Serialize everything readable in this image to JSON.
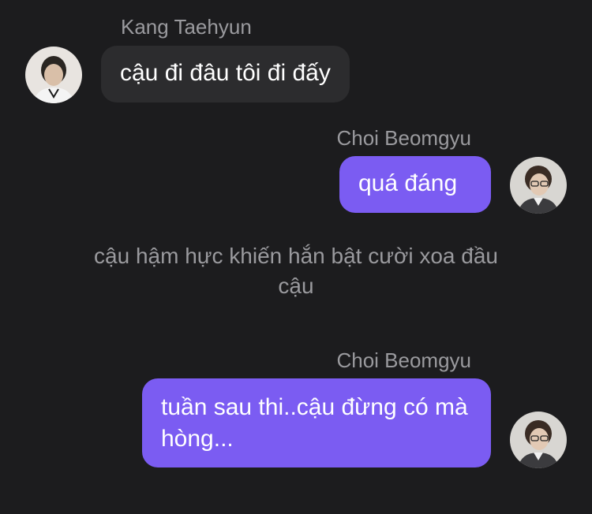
{
  "messages": [
    {
      "sender": "Kang Taehyun",
      "text": "cậu đi đâu tôi đi đấy",
      "side": "left"
    },
    {
      "sender": "Choi Beomgyu",
      "text": "quá đáng",
      "side": "right"
    },
    {
      "narration": "cậu hậm hực khiến hắn bật cười xoa đầu cậu"
    },
    {
      "sender": "Choi Beomgyu",
      "text": "tuần sau thi..cậu đừng có mà hòng...",
      "side": "right"
    }
  ],
  "colors": {
    "background": "#1c1c1e",
    "incoming_bubble": "#2c2c2e",
    "outgoing_bubble": "#7b5cf2",
    "name_text": "#9a9a9e",
    "narration_text": "#9a9a9e"
  },
  "avatars": {
    "taehyun": "avatar-photo",
    "beomgyu": "avatar-photo"
  }
}
